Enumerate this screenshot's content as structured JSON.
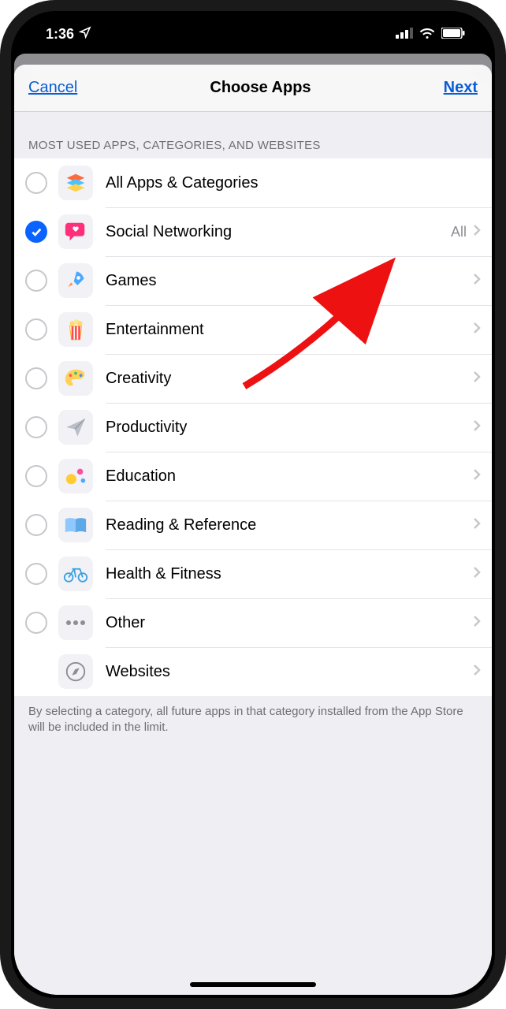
{
  "status": {
    "time": "1:36"
  },
  "nav": {
    "cancel": "Cancel",
    "title": "Choose Apps",
    "next": "Next"
  },
  "section_header": "MOST USED APPS, CATEGORIES, AND WEBSITES",
  "rows": {
    "all": {
      "label": "All Apps & Categories"
    },
    "social": {
      "label": "Social Networking",
      "detail": "All"
    },
    "games": {
      "label": "Games"
    },
    "ent": {
      "label": "Entertainment"
    },
    "create": {
      "label": "Creativity"
    },
    "prod": {
      "label": "Productivity"
    },
    "edu": {
      "label": "Education"
    },
    "read": {
      "label": "Reading & Reference"
    },
    "health": {
      "label": "Health & Fitness"
    },
    "other": {
      "label": "Other"
    },
    "web": {
      "label": "Websites"
    }
  },
  "footer": "By selecting a category, all future apps in that category installed from the App Store will be included in the limit."
}
